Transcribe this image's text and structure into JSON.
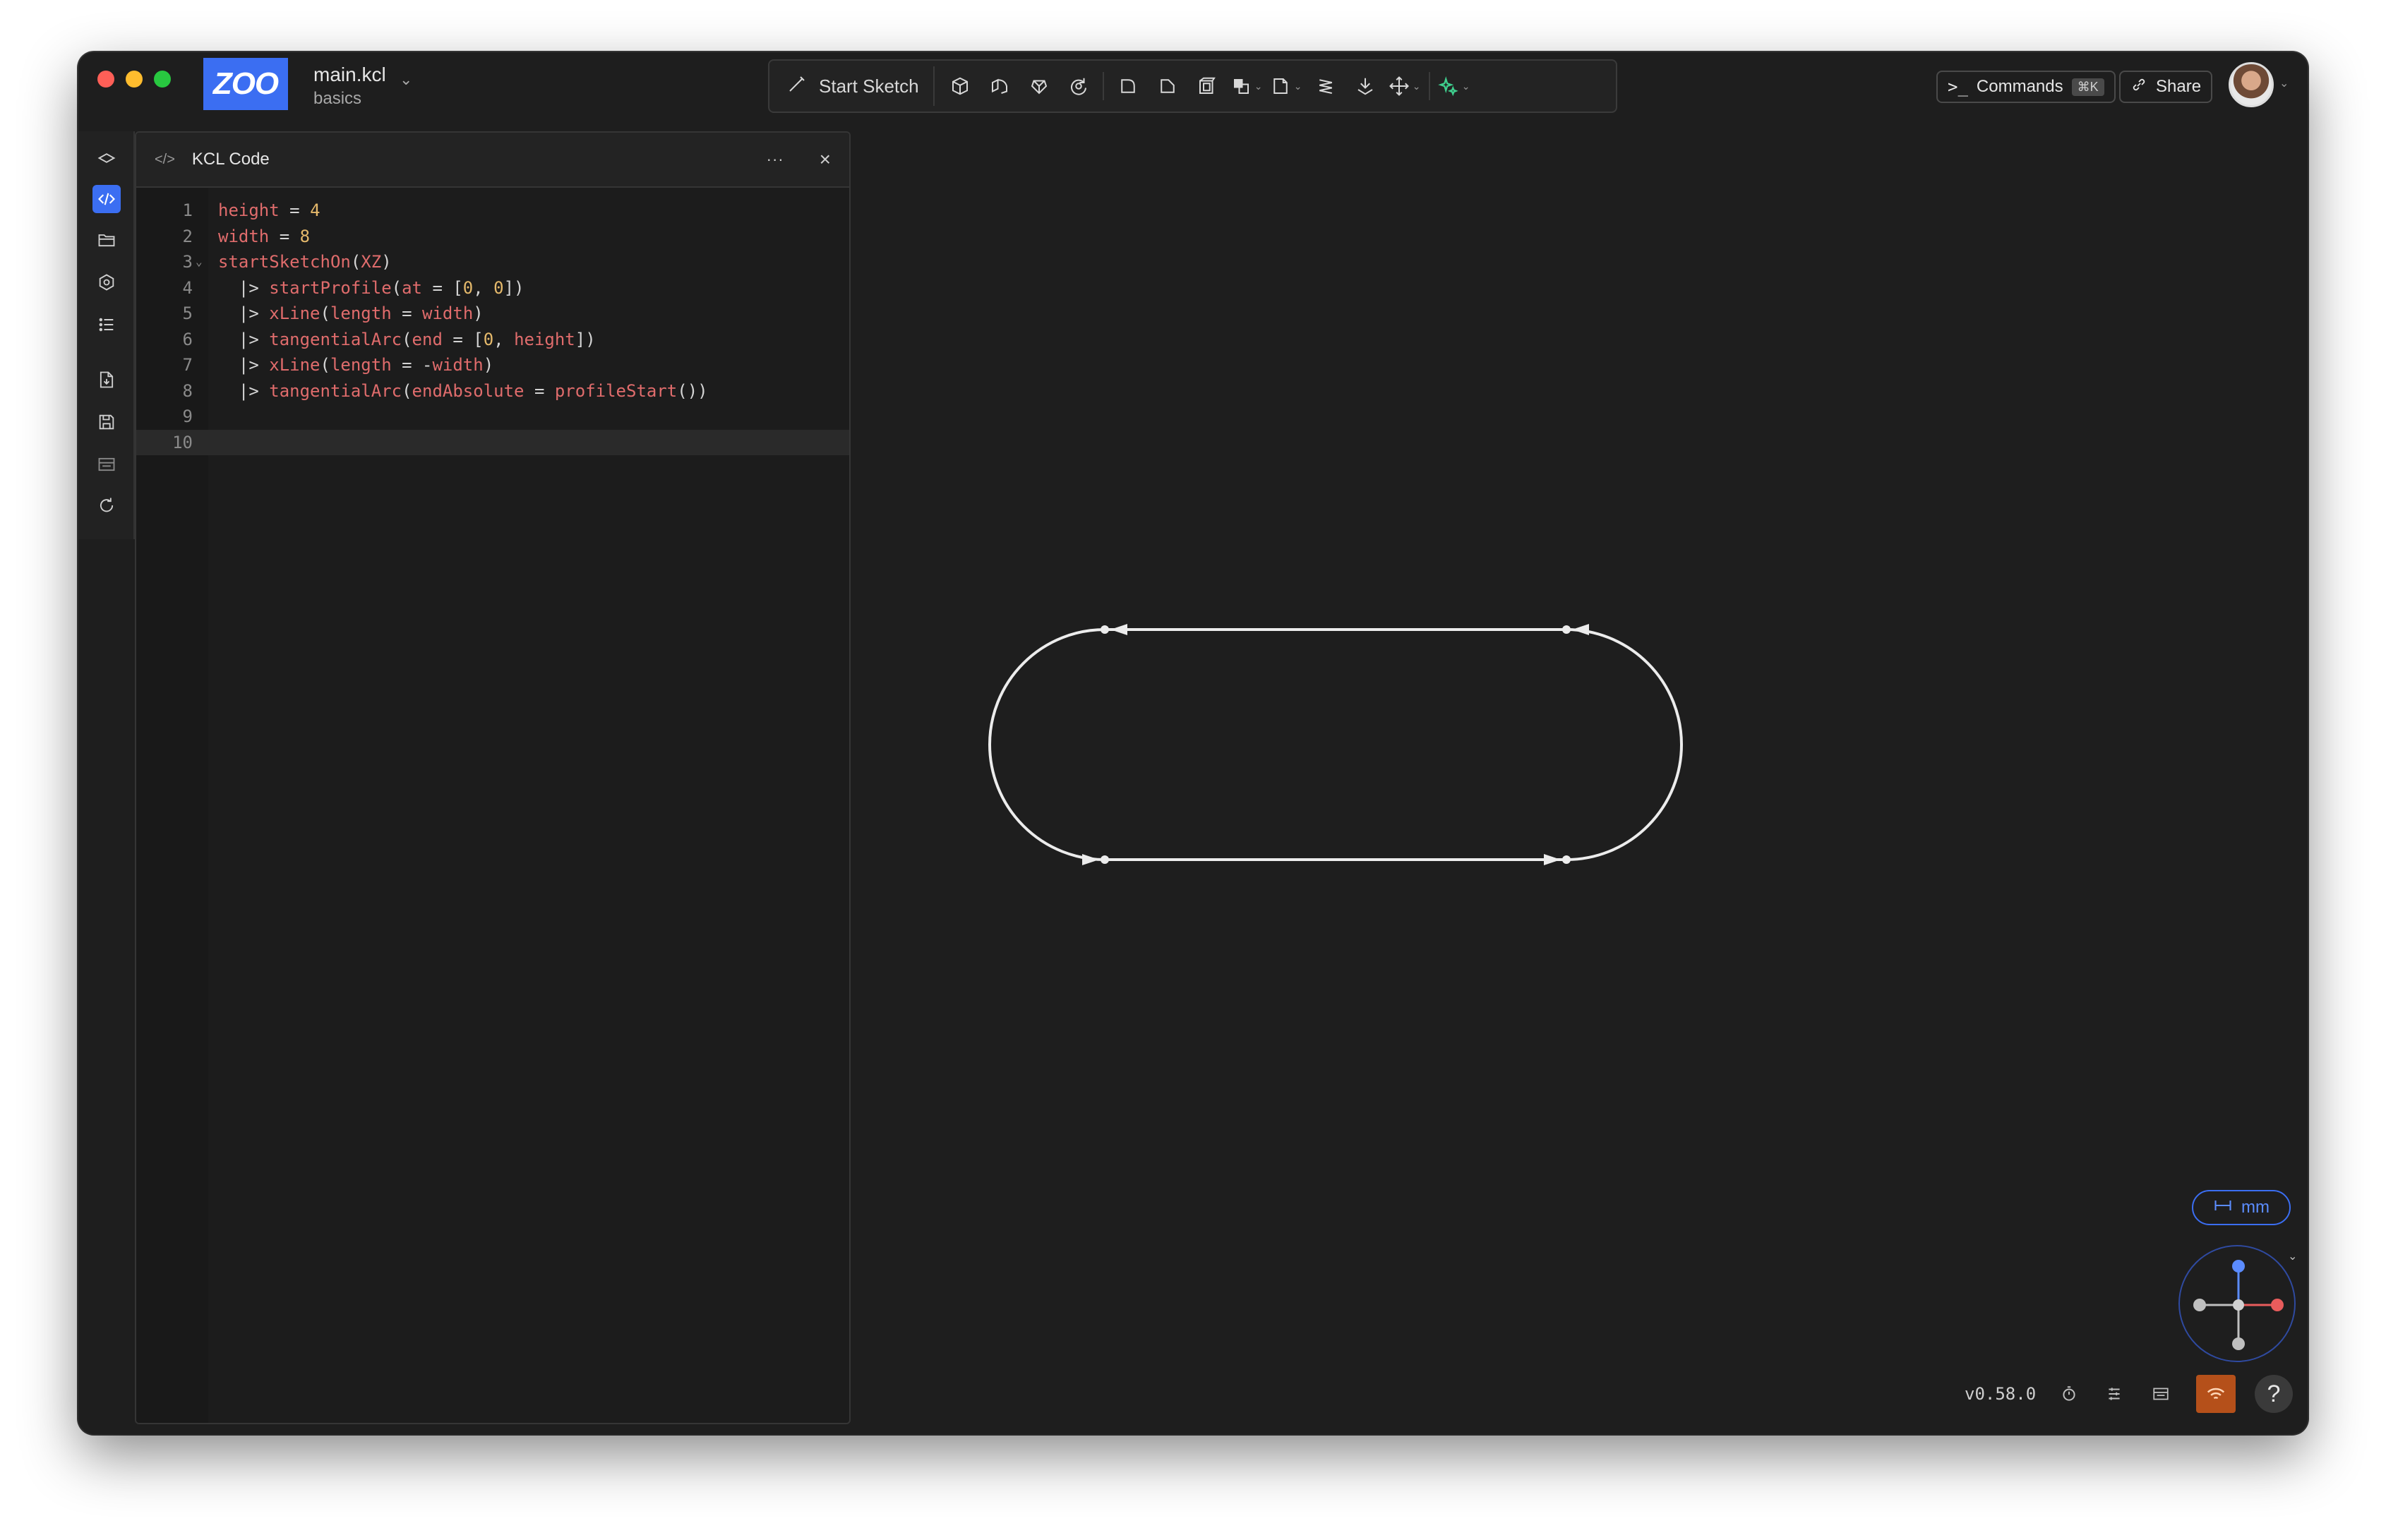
{
  "window": {
    "app_logo": "ZOO"
  },
  "file": {
    "name": "main.kcl",
    "project": "basics"
  },
  "toolbar": {
    "start_sketch_label": "Start Sketch",
    "icons": [
      "extrude-icon",
      "sweep-icon",
      "loft-icon",
      "revolve-icon",
      "fillet-icon",
      "chamfer-icon",
      "shell-icon",
      "boolean-icon",
      "plane-icon",
      "helix-icon",
      "insert-icon",
      "transform-icon",
      "text-to-cad-icon"
    ]
  },
  "header": {
    "commands_label": "Commands",
    "commands_shortcut": "⌘K",
    "share_label": "Share"
  },
  "panel": {
    "title": "KCL Code",
    "more_label": "···",
    "close_label": "×"
  },
  "code": {
    "lines": [
      {
        "n": "1",
        "text": "height = 4"
      },
      {
        "n": "2",
        "text": "width = 8"
      },
      {
        "n": "3",
        "text": "startSketchOn(XZ)"
      },
      {
        "n": "4",
        "text": "  |> startProfile(at = [0, 0])"
      },
      {
        "n": "5",
        "text": "  |> xLine(length = width)"
      },
      {
        "n": "6",
        "text": "  |> tangentialArc(end = [0, height])"
      },
      {
        "n": "7",
        "text": "  |> xLine(length = -width)"
      },
      {
        "n": "8",
        "text": "  |> tangentialArc(endAbsolute = profileStart())"
      },
      {
        "n": "9",
        "text": ""
      },
      {
        "n": "10",
        "text": ""
      }
    ]
  },
  "viewport": {
    "units_label": "mm"
  },
  "status": {
    "version": "v0.58.0",
    "help_label": "?"
  },
  "colors": {
    "accent": "#3b6ef2",
    "network": "#b5501a",
    "axis_x": "#e85c5c",
    "axis_y": "#5b8cff"
  }
}
